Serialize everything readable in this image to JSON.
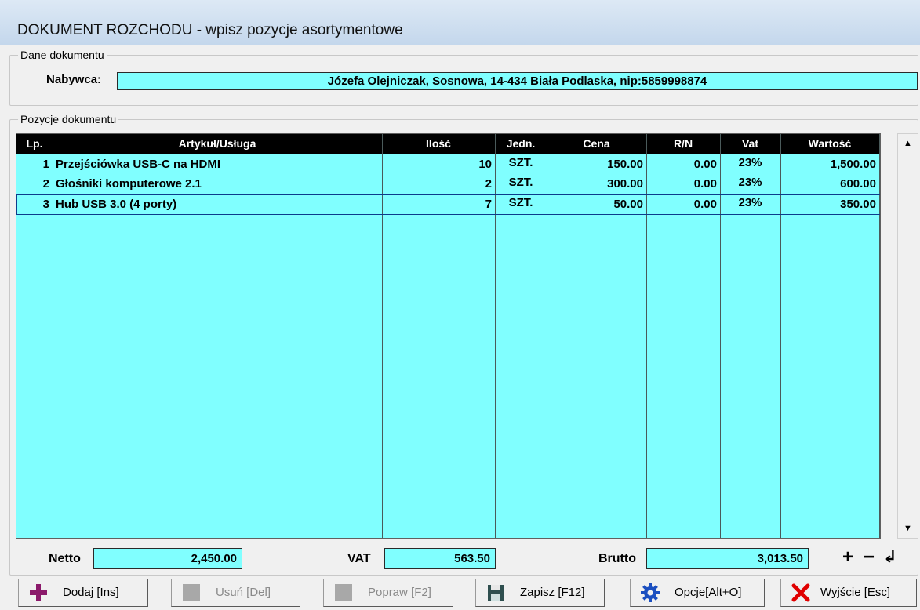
{
  "window": {
    "title": "DOKUMENT ROZCHODU - wpisz pozycje asortymentowe"
  },
  "document": {
    "legend": "Dane dokumentu",
    "buyer_label": "Nabywca:",
    "buyer_value": "Józefa Olejniczak, Sosnowa, 14-434 Biała Podlaska, nip:5859998874"
  },
  "positions": {
    "legend": "Pozycje dokumentu",
    "columns": [
      "Lp.",
      "Artykuł/Usługa",
      "Ilość",
      "Jedn.",
      "Cena",
      "R/N",
      "Vat",
      "Wartość",
      "✓"
    ],
    "rows": [
      {
        "lp": "1",
        "item": "Przejściówka USB-C na HDMI",
        "qty": "10",
        "unit": "SZT.",
        "price": "150.00",
        "rn": "0.00",
        "vat": "23%",
        "value": "1,500.00"
      },
      {
        "lp": "2",
        "item": "Głośniki komputerowe 2.1",
        "qty": "2",
        "unit": "SZT.",
        "price": "300.00",
        "rn": "0.00",
        "vat": "23%",
        "value": "600.00"
      },
      {
        "lp": "3",
        "item": "Hub USB 3.0 (4 porty)",
        "qty": "7",
        "unit": "SZT.",
        "price": "50.00",
        "rn": "0.00",
        "vat": "23%",
        "value": "350.00"
      }
    ],
    "selected_row": 3
  },
  "totals": {
    "netto_label": "Netto",
    "netto": "2,450.00",
    "vat_label": "VAT",
    "vat": "563.50",
    "brutto_label": "Brutto",
    "brutto": "3,013.50"
  },
  "buttons": {
    "add": "Dodaj  [Ins]",
    "delete": "Usuń  [Del]",
    "edit": "Popraw  [F2]",
    "save": "Zapisz  [F12]",
    "options": "Opcje[Alt+O]",
    "exit": "Wyjście  [Esc]"
  },
  "colors": {
    "field": "#80ffff",
    "header": "#000000",
    "add_icon": "#8b1a6b",
    "exit_icon": "#e00000",
    "options_icon": "#1b4fc0"
  }
}
